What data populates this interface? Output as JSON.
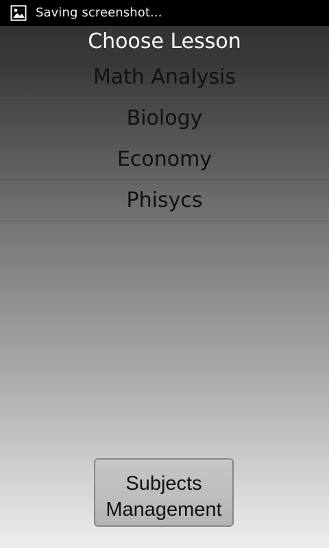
{
  "status_bar": {
    "icon": "image-icon",
    "text": "Saving screenshot..."
  },
  "screen": {
    "title": "Choose Lesson"
  },
  "lessons": [
    {
      "label": "Math Analysis"
    },
    {
      "label": "Biology"
    },
    {
      "label": "Economy"
    },
    {
      "label": "Phisycs"
    }
  ],
  "actions": {
    "subjects_management": "Subjects\nManagement"
  },
  "colors": {
    "status_bar_background": "#000000",
    "title_text": "#ffffff",
    "list_text": "#121212",
    "button_background": "#bdbdbd",
    "button_border": "#858585"
  }
}
